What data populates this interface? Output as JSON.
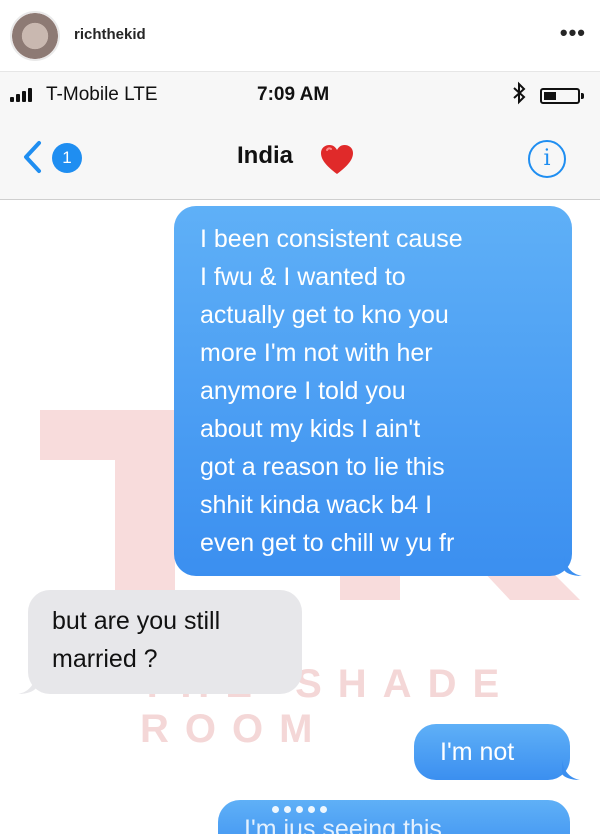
{
  "instagram": {
    "username": "richthekid",
    "more_icon": "more-dots-icon"
  },
  "status_bar": {
    "carrier": "T-Mobile  LTE",
    "time": "7:09 AM",
    "bluetooth_icon": "bluetooth-icon",
    "battery_icon": "battery-icon",
    "battery_level": 0.3
  },
  "nav": {
    "back_icon": "chevron-left-icon",
    "unread_count": "1",
    "contact_name": "India",
    "heart_icon": "red-heart-icon",
    "info_icon": "info-icon",
    "info_glyph": "i"
  },
  "messages": [
    {
      "direction": "sent",
      "lines": [
        "I been consistent cause",
        "I fwu & I wanted to",
        "actually get to kno you",
        "more I'm not with her",
        "anymore I told you",
        "about  my kids I ain't",
        "got a reason to lie this",
        "shhit kinda wack b4 I",
        "even get to chill w yu fr"
      ]
    },
    {
      "direction": "received",
      "lines": [
        "but are you still",
        "married ?"
      ]
    },
    {
      "direction": "sent",
      "lines": [
        "I'm not"
      ]
    },
    {
      "direction": "sent",
      "lines": [
        "I'm jus seeing this"
      ]
    }
  ],
  "watermark": {
    "text": "THE SHADE ROOM"
  },
  "colors": {
    "sent_bubble": "#3b8ff0",
    "received_bubble": "#e7e7ea",
    "ios_blue": "#1f8ef1",
    "heart": "#e02a2a"
  }
}
